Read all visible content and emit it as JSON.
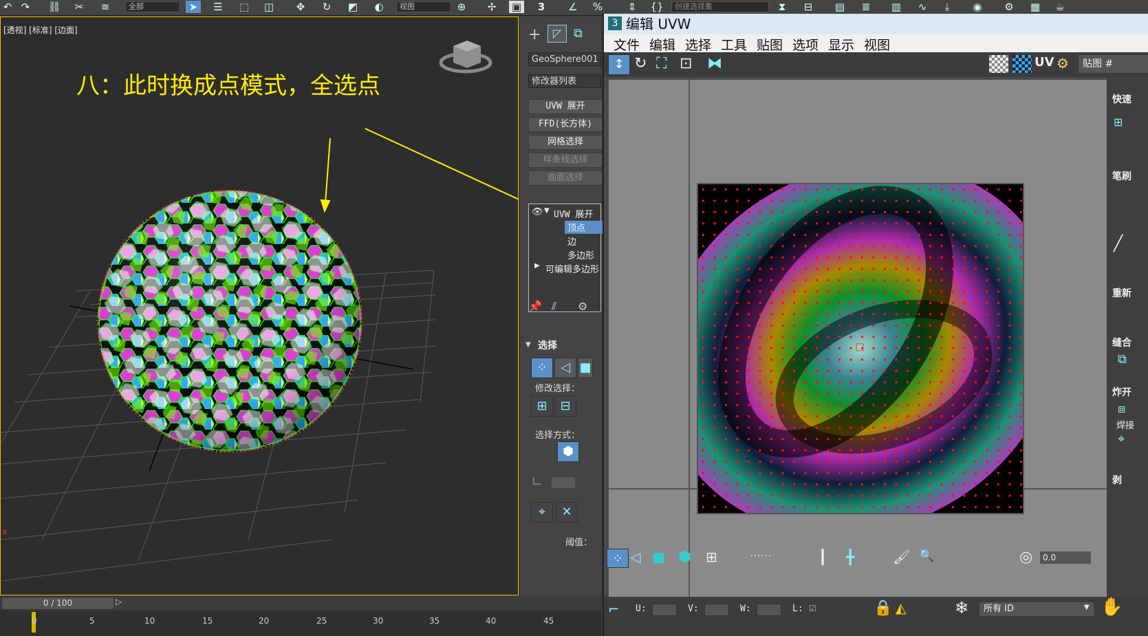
{
  "toolbar": {
    "filter_value": "全部",
    "coord_value": "视图",
    "selection_set_placeholder": "创建选择集",
    "snap_label": "3"
  },
  "viewport": {
    "label": "[透视] [标准] [边面]",
    "annotation": "八：此时换成点模式，全选点"
  },
  "command_panel": {
    "object_name": "GeoSphere001",
    "modifier_list": "修改器列表",
    "buttons": [
      "UVW 展开",
      "FFD(长方体)",
      "网格选择",
      "样条线选择",
      "曲面选择"
    ],
    "stack": {
      "modifier": "UVW 展开",
      "sub_items": [
        "顶点",
        "边",
        "多边形"
      ],
      "base": "可编辑多边形"
    },
    "selection_section": {
      "title": "选择",
      "modify_selection": "修改选择：",
      "select_by": "选择方式：",
      "threshold": "阈值："
    }
  },
  "timeline": {
    "frame_display": "0 / 100",
    "ticks": [
      "0",
      "5",
      "10",
      "15",
      "20",
      "25",
      "30",
      "35",
      "40",
      "45"
    ]
  },
  "uvw_window": {
    "title": "编辑 UVW",
    "menu": [
      "文件",
      "编辑",
      "选择",
      "工具",
      "贴图",
      "选项",
      "显示",
      "视图"
    ],
    "uv_label": "UV",
    "map_label": "贴图 #",
    "right_panel_sections": [
      "快速",
      "笔刷",
      "重新",
      "缝合",
      "炸开",
      "剥"
    ],
    "weld_label": "焊接",
    "offset_value": "0.0",
    "u_label": "U:",
    "v_label": "V:",
    "w_label": "W:",
    "l_label": "L:",
    "id_filter": "所有 ID"
  }
}
